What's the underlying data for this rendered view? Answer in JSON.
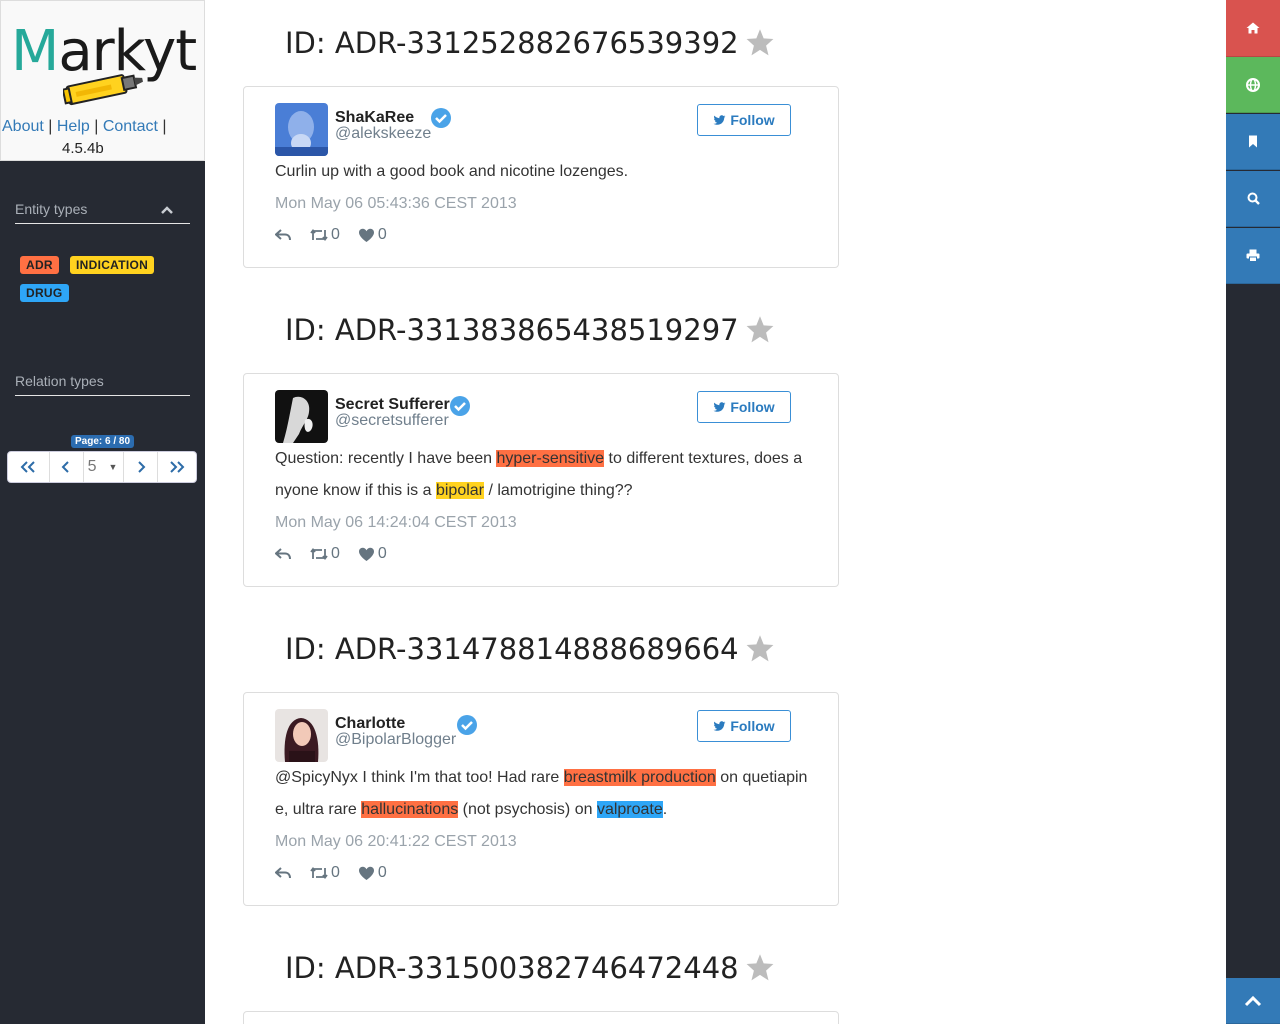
{
  "app": {
    "logo_text_m": "M",
    "logo_text_rest": "arkyt",
    "links": [
      "About",
      "Help",
      "Contact"
    ],
    "version": "4.5.4b"
  },
  "sidebar": {
    "entity_types_label": "Entity types",
    "entity_badges": [
      {
        "label": "ADR",
        "color": "#ff7043"
      },
      {
        "label": "INDICATION",
        "color": "#ffd21f"
      },
      {
        "label": "DRUG",
        "color": "#2ea6f7"
      }
    ],
    "relation_types_label": "Relation types",
    "pagination": {
      "page_label": "Page: 6 / 80",
      "selected_value": "5"
    }
  },
  "tweets": [
    {
      "id_label": "ID: ADR-331252882676539392",
      "user_name": "ShaKaRee",
      "user_handle": "@alekskeeze",
      "follow_label": "Follow",
      "text_parts": [
        "Curlin up with a good book and nicotine lozenges."
      ],
      "timestamp": "Mon May 06 05:43:36 CEST 2013",
      "retweets": "0",
      "likes": "0"
    },
    {
      "id_label": "ID: ADR-331383865438519297",
      "user_name": "Secret Sufferer",
      "user_handle": "@secretsufferer",
      "follow_label": "Follow",
      "text_parts": [
        "Question: recently I have been ",
        "hyper-sensitive",
        " to different textures, does a nyone know if this is a ",
        "bipolar",
        " / lamotrigine thing??"
      ],
      "timestamp": "Mon May 06 14:24:04 CEST 2013",
      "retweets": "0",
      "likes": "0"
    },
    {
      "id_label": "ID: ADR-331478814888689664",
      "user_name": "Charlotte",
      "user_handle": "@BipolarBlogger",
      "follow_label": "Follow",
      "text_parts": [
        "@SpicyNyx I think I'm that too! Had rare ",
        "breastmilk production",
        " on quetiapin e, ultra rare ",
        "hallucinations",
        " (not psychosis) on ",
        "valproate",
        "."
      ],
      "timestamp": "Mon May 06 20:41:22 CEST 2013",
      "retweets": "0",
      "likes": "0"
    },
    {
      "id_label": "ID: ADR-331500382746472448"
    }
  ],
  "colors": {
    "sidebar_bg": "#262a33",
    "home_btn": "#d9534f",
    "globe_btn": "#5cb85c",
    "nav_btn": "#337ab7"
  },
  "right_nav_icons": [
    "home-icon",
    "globe-icon",
    "bookmark-icon",
    "search-icon",
    "print-icon",
    "chevron-up-icon"
  ]
}
